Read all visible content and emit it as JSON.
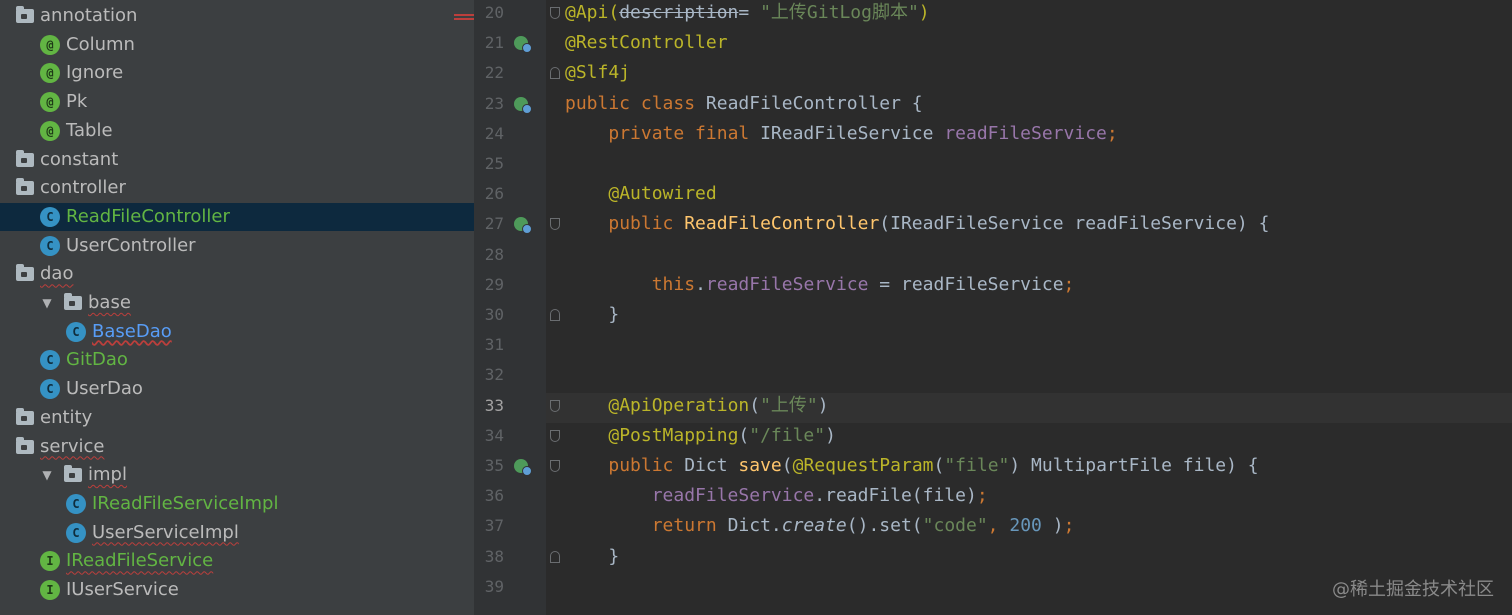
{
  "project_tree": [
    {
      "label": "annotation",
      "kind": "folder",
      "indent": 0,
      "arrow": ""
    },
    {
      "label": "Column",
      "kind": "annotation",
      "indent": 1,
      "style": "normal"
    },
    {
      "label": "Ignore",
      "kind": "annotation",
      "indent": 1,
      "style": "normal"
    },
    {
      "label": "Pk",
      "kind": "annotation",
      "indent": 1,
      "style": "normal"
    },
    {
      "label": "Table",
      "kind": "annotation",
      "indent": 1,
      "style": "normal"
    },
    {
      "label": "constant",
      "kind": "folder",
      "indent": 0,
      "arrow": ""
    },
    {
      "label": "controller",
      "kind": "folder",
      "indent": 0,
      "arrow": ""
    },
    {
      "label": "ReadFileController",
      "kind": "class",
      "indent": 1,
      "style": "green",
      "selected": true
    },
    {
      "label": "UserController",
      "kind": "class",
      "indent": 1,
      "style": "normal"
    },
    {
      "label": "dao",
      "kind": "folder",
      "indent": 0,
      "arrow": "",
      "squig": true
    },
    {
      "label": "base",
      "kind": "folder",
      "indent": 1,
      "arrow": "▼",
      "squig": true
    },
    {
      "label": "BaseDao",
      "kind": "class",
      "indent": 2,
      "style": "blue"
    },
    {
      "label": "GitDao",
      "kind": "class",
      "indent": 1,
      "style": "green"
    },
    {
      "label": "UserDao",
      "kind": "class",
      "indent": 1,
      "style": "normal"
    },
    {
      "label": "entity",
      "kind": "folder",
      "indent": 0,
      "arrow": ""
    },
    {
      "label": "service",
      "kind": "folder",
      "indent": 0,
      "arrow": "",
      "squig": true
    },
    {
      "label": "impl",
      "kind": "folder",
      "indent": 1,
      "arrow": "▼",
      "squig": true
    },
    {
      "label": "IReadFileServiceImpl",
      "kind": "class",
      "indent": 2,
      "style": "green"
    },
    {
      "label": "UserServiceImpl",
      "kind": "class",
      "indent": 2,
      "style": "normal",
      "squig": true
    },
    {
      "label": "IReadFileService",
      "kind": "interface",
      "indent": 1,
      "style": "green",
      "squig": true
    },
    {
      "label": "IUserService",
      "kind": "interface",
      "indent": 1,
      "style": "normal"
    }
  ],
  "icon_letters": {
    "annotation": "@",
    "class": "C",
    "interface": "I"
  },
  "line_numbers": [
    "20",
    "21",
    "22",
    "23",
    "24",
    "25",
    "26",
    "27",
    "28",
    "29",
    "30",
    "31",
    "32",
    "33",
    "34",
    "35",
    "36",
    "37",
    "38",
    "39"
  ],
  "current_line": "33",
  "code_lines": [
    [
      [
        "ann",
        "@Api("
      ],
      [
        "strike",
        "description"
      ],
      [
        "",
        "= "
      ],
      [
        "str",
        "\"上传GitLog脚本\""
      ],
      [
        "ann",
        ")"
      ]
    ],
    [
      [
        "ann",
        "@RestController"
      ]
    ],
    [
      [
        "ann",
        "@Slf4j"
      ]
    ],
    [
      [
        "kw",
        "public class "
      ],
      [
        "",
        "ReadFileController {"
      ]
    ],
    [
      [
        "",
        "    "
      ],
      [
        "kw",
        "private final "
      ],
      [
        "",
        "IReadFileService "
      ],
      [
        "fld",
        "readFileService"
      ],
      [
        "kw",
        ";"
      ]
    ],
    [],
    [
      [
        "",
        "    "
      ],
      [
        "ann",
        "@Autowired"
      ]
    ],
    [
      [
        "",
        "    "
      ],
      [
        "kw",
        "public "
      ],
      [
        "mth",
        "ReadFileController"
      ],
      [
        "",
        "(IReadFileService readFileService) {"
      ]
    ],
    [],
    [
      [
        "",
        "        "
      ],
      [
        "kw",
        "this"
      ],
      [
        "",
        "."
      ],
      [
        "fld",
        "readFileService"
      ],
      [
        "",
        " = readFileService"
      ],
      [
        "kw",
        ";"
      ]
    ],
    [
      [
        "",
        "    }"
      ]
    ],
    [],
    [],
    [
      [
        "",
        "    "
      ],
      [
        "ann",
        "@ApiOperation"
      ],
      [
        "",
        "("
      ],
      [
        "str",
        "\"上传\""
      ],
      [
        "",
        ")"
      ]
    ],
    [
      [
        "",
        "    "
      ],
      [
        "ann",
        "@PostMapping"
      ],
      [
        "",
        "("
      ],
      [
        "str",
        "\"/file\""
      ],
      [
        "",
        ")"
      ]
    ],
    [
      [
        "",
        "    "
      ],
      [
        "kw",
        "public "
      ],
      [
        "",
        "Dict "
      ],
      [
        "mth",
        "save"
      ],
      [
        "",
        "("
      ],
      [
        "ann",
        "@RequestParam"
      ],
      [
        "",
        "("
      ],
      [
        "str",
        "\"file\""
      ],
      [
        "",
        ") MultipartFile file) {"
      ]
    ],
    [
      [
        "",
        "        "
      ],
      [
        "fld",
        "readFileService"
      ],
      [
        "",
        ".readFile(file)"
      ],
      [
        "kw",
        ";"
      ]
    ],
    [
      [
        "",
        "        "
      ],
      [
        "kw",
        "return "
      ],
      [
        "",
        "Dict."
      ],
      [
        "it",
        "create"
      ],
      [
        "",
        "().set("
      ],
      [
        "str",
        "\"code\""
      ],
      [
        "kw",
        ", "
      ],
      [
        "num",
        "200"
      ],
      [
        "",
        " )"
      ],
      [
        "kw",
        ";"
      ]
    ],
    [
      [
        "",
        "    }"
      ]
    ],
    []
  ],
  "watermark": "@稀土掘金技术社区"
}
